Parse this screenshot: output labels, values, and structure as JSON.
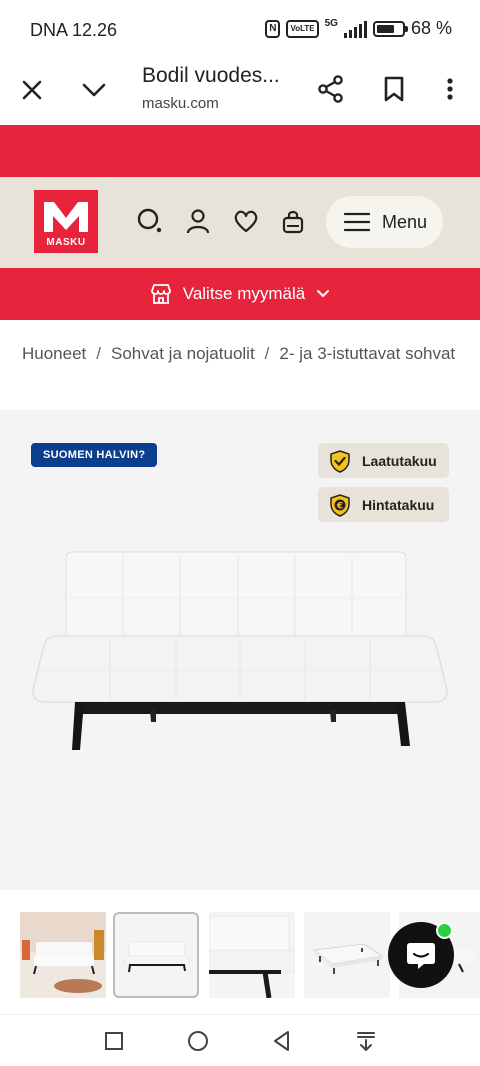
{
  "status_bar": {
    "time": "DNA 12.26",
    "nfc_label": "N",
    "volte_label": "VoLTE",
    "network_label": "5G",
    "battery_percent": "68 %"
  },
  "browser": {
    "page_title": "Bodil vuodes...",
    "url": "masku.com"
  },
  "header": {
    "logo_text": "MASKU",
    "menu_label": "Menu",
    "icons": [
      "search-icon",
      "account-icon",
      "heart-icon",
      "cart-icon"
    ]
  },
  "store_bar": {
    "label": "Valitse myymälä"
  },
  "breadcrumb": {
    "items": [
      "Huoneet",
      "Sohvat ja nojatuolit",
      "2- ja 3-istuttavat sohvat"
    ],
    "separator": "/"
  },
  "product_gallery": {
    "badge": "SUOMEN HALVIN?",
    "guarantees": [
      {
        "label": "Laatutakuu",
        "icon": "checkmark-shield-icon"
      },
      {
        "label": "Hintatakuu",
        "icon": "euro-shield-icon"
      }
    ],
    "thumbnails_count_visible": 5,
    "active_thumbnail": 2
  },
  "colors": {
    "brand_red": "#e8243c",
    "header_beige": "#e8e3d9",
    "badge_blue": "#0b3e8c",
    "shield_yellow": "#f4c21a",
    "online_green": "#2ecc40"
  }
}
